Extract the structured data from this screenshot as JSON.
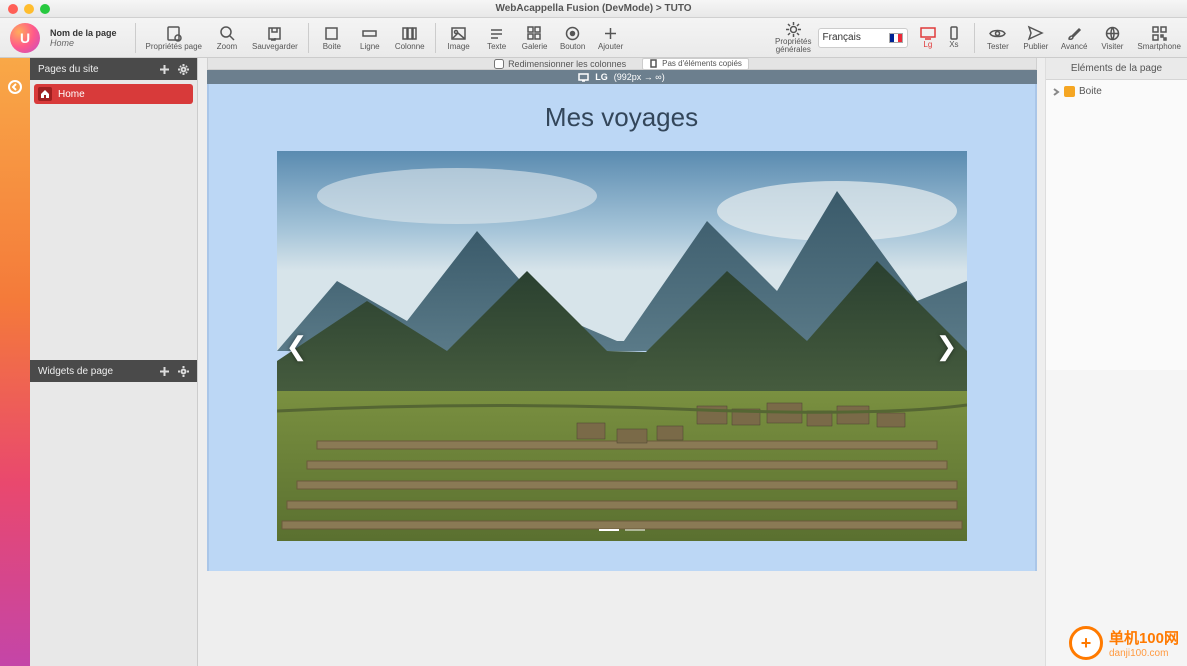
{
  "window_title": "WebAcappella Fusion (DevMode) > TUTO",
  "page_name": {
    "label": "Nom de la page",
    "value": "Home"
  },
  "toolbar": {
    "props": "Propriétés page",
    "zoom": "Zoom",
    "save": "Sauvegarder",
    "box": "Boite",
    "line": "Ligne",
    "column": "Colonne",
    "image": "Image",
    "text": "Texte",
    "gallery": "Galerie",
    "button": "Bouton",
    "add": "Ajouter",
    "general_props": "Propriétés\ngénérales",
    "language": "Français",
    "lg": "Lg",
    "xs": "Xs",
    "tester": "Tester",
    "publish": "Publier",
    "advanced": "Avancé",
    "visit": "Visiter",
    "smartphone": "Smartphone"
  },
  "left": {
    "pages_title": "Pages du site",
    "page_items": [
      "Home"
    ],
    "widgets_title": "Widgets de page"
  },
  "canvas": {
    "resize_cols": "Redimensionner les colonnes",
    "no_paste": "Pas d'éléments copiés",
    "breakpoint_label": "LG",
    "breakpoint_range": "(992px → ∞)",
    "page_heading": "Mes voyages"
  },
  "right": {
    "title": "Eléments de la page",
    "items": [
      "Boite"
    ]
  },
  "watermark": {
    "brand": "单机100网",
    "url": "danji100.com",
    "plus": "+"
  }
}
